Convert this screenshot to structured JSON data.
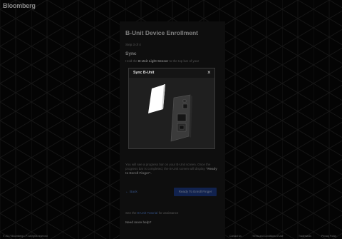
{
  "brand": "Bloomberg",
  "enrollment": {
    "title": "B-Unit Device Enrollment",
    "step": "Step 3 of 4",
    "section": "Sync",
    "instruction_prefix": "Hold the",
    "instruction_bold": "B-Unit Light Sensor",
    "instruction_suffix": "to the top bar of your",
    "progress_line1": "You will see a progress bar on your B-Unit screen.",
    "progress_line2": "Once the progress bar is completed, the B-Unit screen will display",
    "progress_bold": "\"Ready to Enroll Finger\".",
    "back_label": "Back",
    "ready_label": "Ready To Enroll Finger",
    "guide_prefix": "See the",
    "guide_link": "B-Unit Tutorial",
    "guide_suffix": "for assistance",
    "help_label": "Need more help?"
  },
  "modal": {
    "title": "Sync B-Unit",
    "close": "×"
  },
  "footer": {
    "copyright": "© 2017 Bloomberg L.P. All rights reserved",
    "links": [
      "Contact Us",
      "Terms and Conditions of Use",
      "Trademarks",
      "Privacy Policy"
    ]
  },
  "colors": {
    "accent": "#5b8de8",
    "button": "#1f3f8f",
    "background": "#090909"
  }
}
